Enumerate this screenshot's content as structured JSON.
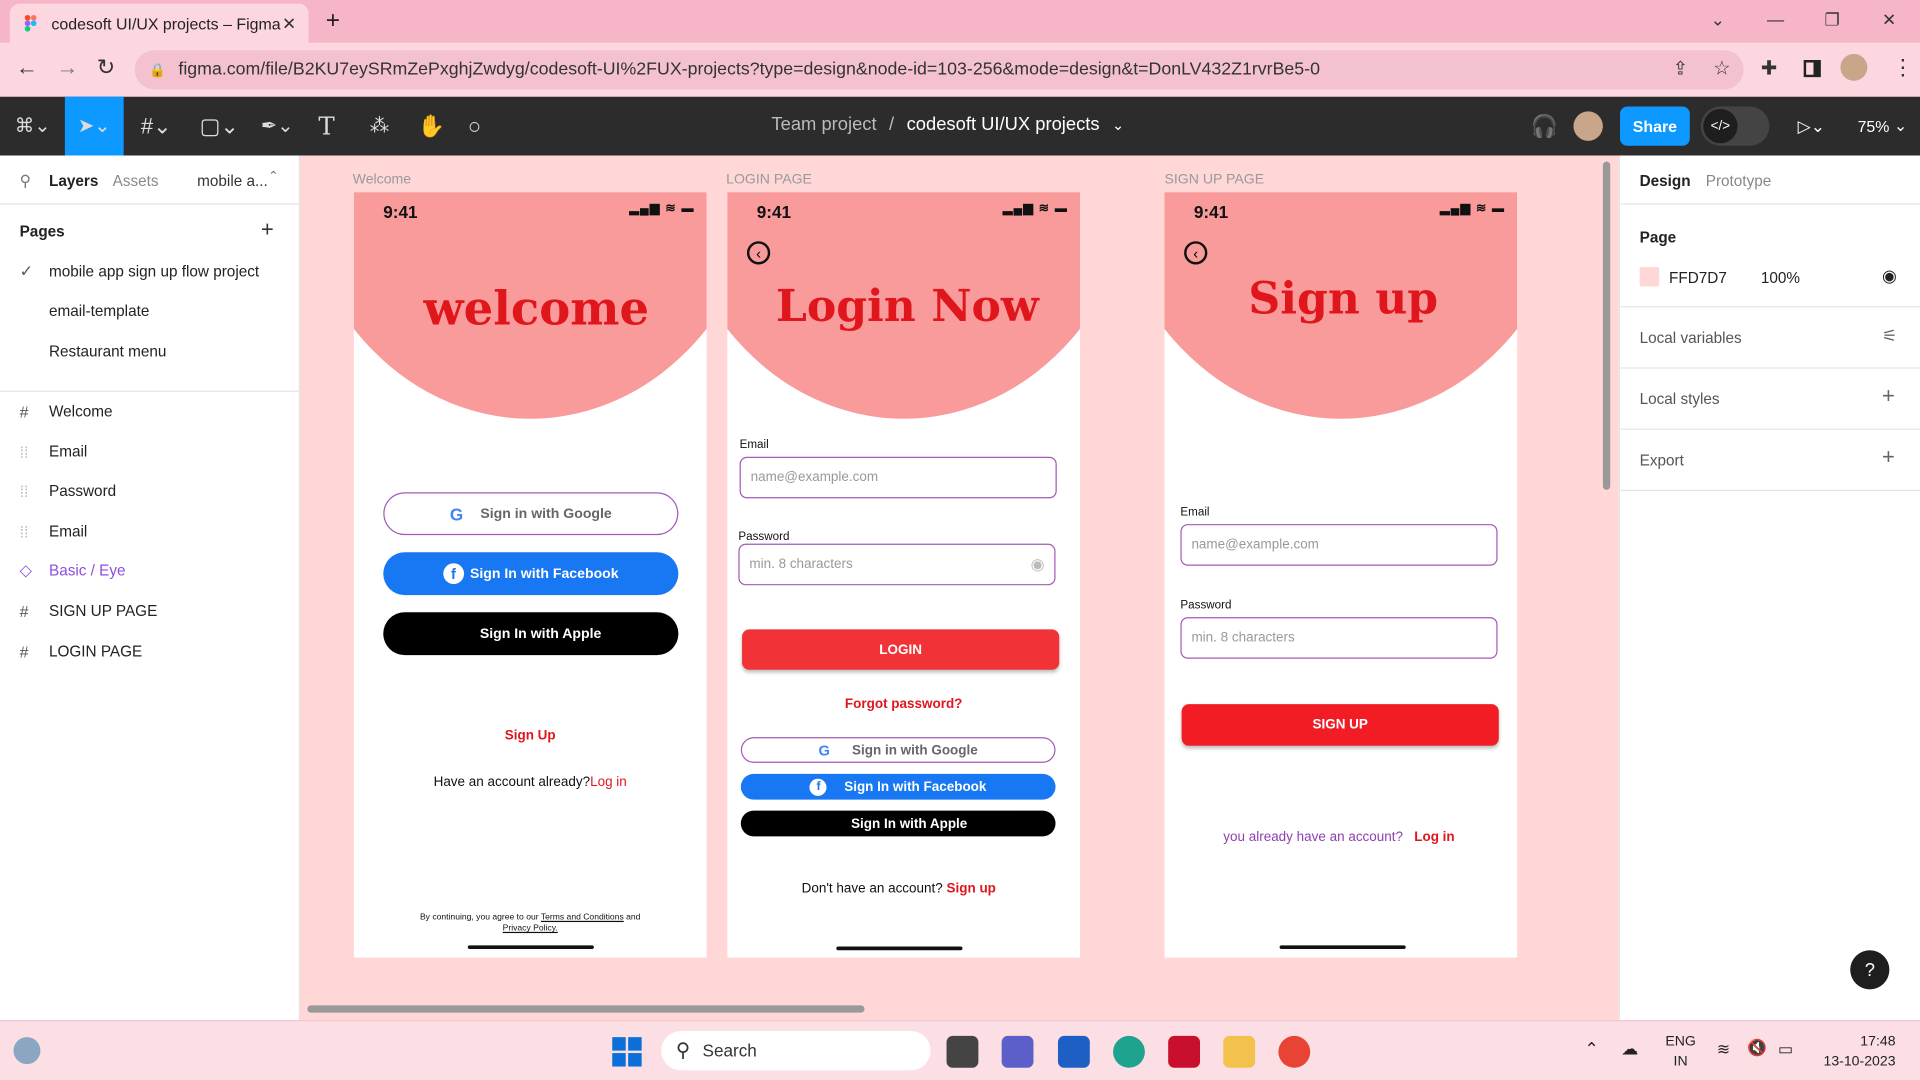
{
  "browser": {
    "tab_title": "codesoft UI/UX projects – Figma",
    "url": "figma.com/file/B2KU7eySRmZePxghjZwdyg/codesoft-UI%2FUX-projects?type=design&node-id=103-256&mode=design&t=DonLV432Z1rvrBe5-0"
  },
  "toolbar": {
    "team": "Team project",
    "separator": "/",
    "file_name": "codesoft UI/UX projects",
    "share_label": "Share",
    "zoom": "75%",
    "dev_label": "</>"
  },
  "left_panel": {
    "tabs": [
      "Layers",
      "Assets",
      "mobile a..."
    ],
    "pages_heading": "Pages",
    "pages": [
      "mobile app sign up flow project",
      "email-template",
      "Restaurant menu"
    ],
    "layers": [
      {
        "label": "Welcome",
        "icon": "frame-icon"
      },
      {
        "label": "Email",
        "icon": "group-icon"
      },
      {
        "label": "Password",
        "icon": "group-icon"
      },
      {
        "label": "Email",
        "icon": "group-icon"
      },
      {
        "label": "Basic / Eye",
        "icon": "component-icon"
      },
      {
        "label": "SIGN UP PAGE",
        "icon": "frame-icon"
      },
      {
        "label": "LOGIN PAGE",
        "icon": "frame-icon"
      }
    ]
  },
  "right_panel": {
    "tabs": [
      "Design",
      "Prototype"
    ],
    "page_heading": "Page",
    "page_color": "FFD7D7",
    "page_opacity": "100%",
    "sections": [
      "Local variables",
      "Local styles",
      "Export"
    ],
    "help": "?"
  },
  "frames": {
    "welcome": {
      "label": "Welcome",
      "time": "9:41",
      "title": "welcome",
      "google": "Sign in with Google",
      "facebook": "Sign In with Facebook",
      "apple": "Sign In with Apple",
      "signup": "Sign Up",
      "have_account": "Have an account already?",
      "login": "Log in",
      "terms_1": "By continuing, you agree to our",
      "terms_link": "Terms and Conditions",
      "terms_and": "and",
      "privacy": "Privacy Policy."
    },
    "login": {
      "label": "LOGIN PAGE",
      "time": "9:41",
      "title": "Login Now",
      "email_label": "Email",
      "email_placeholder": "name@example.com",
      "password_label": "Password",
      "password_placeholder": "min. 8 characters",
      "login_btn": "LOGIN",
      "forgot": "Forgot password?",
      "google": "Sign in with Google",
      "facebook": "Sign In with Facebook",
      "apple": "Sign In with Apple",
      "no_account": "Don't have an account?",
      "signup": "Sign up"
    },
    "signup": {
      "label": "SIGN UP PAGE",
      "time": "9:41",
      "title": "Sign up",
      "email_label": "Email",
      "email_placeholder": "name@example.com",
      "password_label": "Password",
      "password_placeholder": "min. 8 characters",
      "signup_btn": "SIGN UP",
      "already": "you  already have an account?",
      "login": "Log in"
    }
  },
  "taskbar": {
    "search": "Search",
    "lang_1": "ENG",
    "lang_2": "IN",
    "time": "17:48",
    "date": "13-10-2023"
  },
  "colors": {
    "accent": "#0d99ff",
    "brand_red": "#e0161d",
    "canvas_bg": "#ffd7d7",
    "header_pink": "#f99b9b",
    "field_border": "#a35ab8"
  }
}
